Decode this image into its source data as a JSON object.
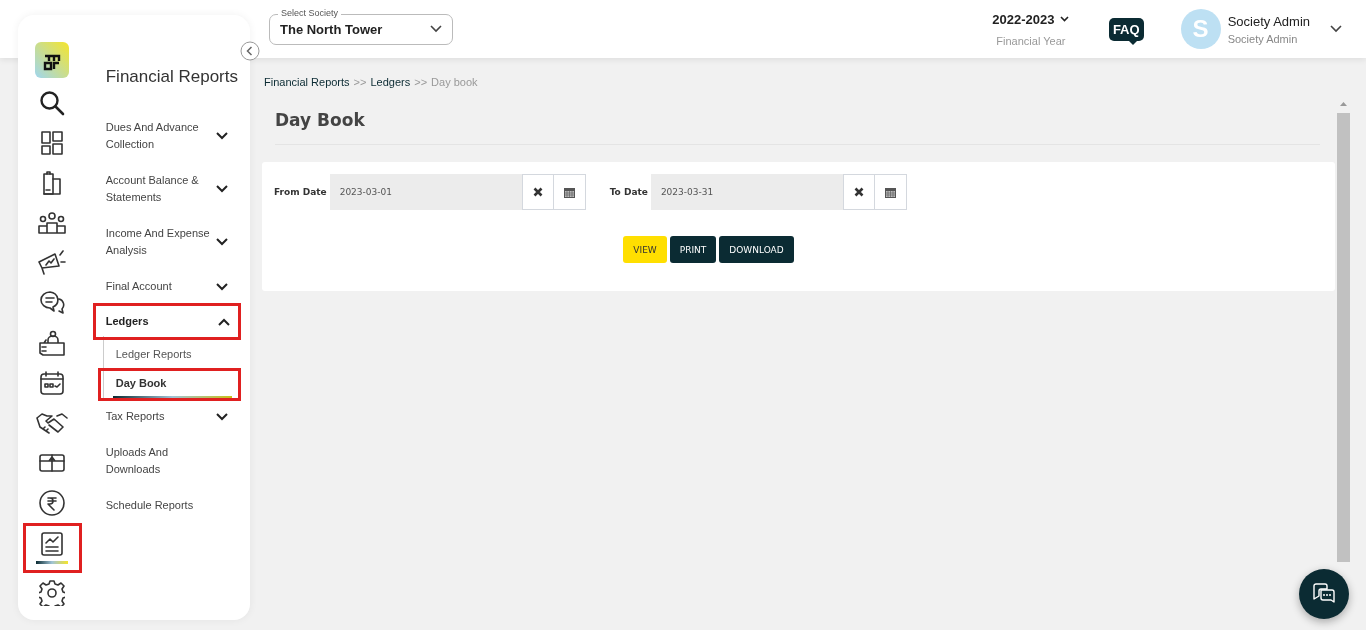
{
  "rail": {
    "items": [
      {
        "kind": "logo",
        "selected": false,
        "highlighted": false
      },
      {
        "kind": "search",
        "selected": false,
        "highlighted": false
      },
      {
        "kind": "dashboard",
        "selected": false,
        "highlighted": false
      },
      {
        "kind": "building",
        "selected": false,
        "highlighted": false
      },
      {
        "kind": "people",
        "selected": false,
        "highlighted": false
      },
      {
        "kind": "megaphone",
        "selected": false,
        "highlighted": false
      },
      {
        "kind": "chat",
        "selected": false,
        "highlighted": false
      },
      {
        "kind": "desk",
        "selected": false,
        "highlighted": false
      },
      {
        "kind": "calendar",
        "selected": false,
        "highlighted": false
      },
      {
        "kind": "handshake",
        "selected": false,
        "highlighted": false
      },
      {
        "kind": "box",
        "selected": false,
        "highlighted": false
      },
      {
        "kind": "rupee",
        "selected": false,
        "highlighted": false
      },
      {
        "kind": "reports",
        "selected": true,
        "highlighted": true
      },
      {
        "kind": "settings",
        "selected": false,
        "highlighted": false
      }
    ]
  },
  "menu": {
    "title": "Financial Reports",
    "items": [
      {
        "kind": "group",
        "label": "Dues And Advance Collection",
        "expanded": false,
        "highlighted": false
      },
      {
        "kind": "group",
        "label": "Account Balance & Statements",
        "expanded": false,
        "highlighted": false
      },
      {
        "kind": "group",
        "label": "Income And Expense Analysis",
        "expanded": false,
        "highlighted": false
      },
      {
        "kind": "group",
        "label": "Final Account",
        "expanded": false,
        "highlighted": false
      },
      {
        "kind": "group",
        "label": "Ledgers",
        "expanded": true,
        "highlighted": true,
        "children": [
          {
            "label": "Ledger Reports",
            "selected": false,
            "highlighted": false
          },
          {
            "label": "Day Book",
            "selected": true,
            "highlighted": true
          }
        ]
      },
      {
        "kind": "group",
        "label": "Tax Reports",
        "expanded": false,
        "highlighted": false
      },
      {
        "kind": "link",
        "label": "Uploads And Downloads",
        "highlighted": false
      },
      {
        "kind": "link",
        "label": "Schedule Reports",
        "highlighted": false
      }
    ]
  },
  "header": {
    "society": {
      "label": "Select Society",
      "value": "The North Tower"
    },
    "year": {
      "value": "2022-2023",
      "caption": "Financial Year"
    },
    "faq": "FAQ",
    "user": {
      "initial": "S",
      "name": "Society Admin",
      "role": "Society Admin"
    }
  },
  "breadcrumb": {
    "separator": ">>",
    "items": [
      "Financial Reports",
      "Ledgers",
      "Day book"
    ]
  },
  "page_title": "Day Book",
  "filters": [
    {
      "label": "From Date",
      "value": "2023-03-01"
    },
    {
      "label": "To Date",
      "value": "2023-03-31"
    }
  ],
  "buttons": [
    {
      "kind": "primary",
      "label": "VIEW"
    },
    {
      "kind": "dark",
      "label": "PRINT"
    },
    {
      "kind": "dark",
      "label": "DOWNLOAD"
    }
  ]
}
